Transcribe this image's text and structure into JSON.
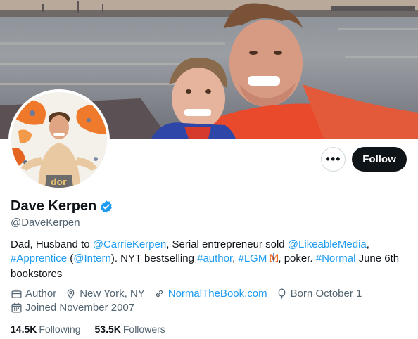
{
  "profile": {
    "display_name": "Dave Kerpen",
    "handle": "@DaveKerpen",
    "verified_icon": "verified-badge-icon",
    "bio": {
      "t1": "Dad, Husband to ",
      "l1": "@CarrieKerpen",
      "t2": ", Serial entrepreneur sold ",
      "l2": "@LikeableMedia",
      "t3": ",",
      "l3": "#Apprentice",
      "t4": " (",
      "l4": "@Intern",
      "t5": "). NYT bestselling ",
      "l5": "#author",
      "t6": ", ",
      "l6": "#LGM",
      "t7": ", poker. ",
      "l7": "#Normal",
      "t8": " June 6th bookstores"
    },
    "meta": {
      "occupation": "Author",
      "location": "New York, NY",
      "website": "NormalTheBook.com",
      "birthday": "Born October 1",
      "joined": "Joined November 2007"
    },
    "stats": {
      "following_count": "14.5K",
      "following_label": "Following",
      "followers_count": "53.5K",
      "followers_label": "Followers"
    }
  },
  "actions": {
    "more_label": "•••",
    "follow_label": "Follow"
  },
  "colors": {
    "link": "#1d9bf0",
    "verified": "#1d9bf0",
    "secondary_text": "#536471",
    "follow_button": "#0f1419"
  }
}
